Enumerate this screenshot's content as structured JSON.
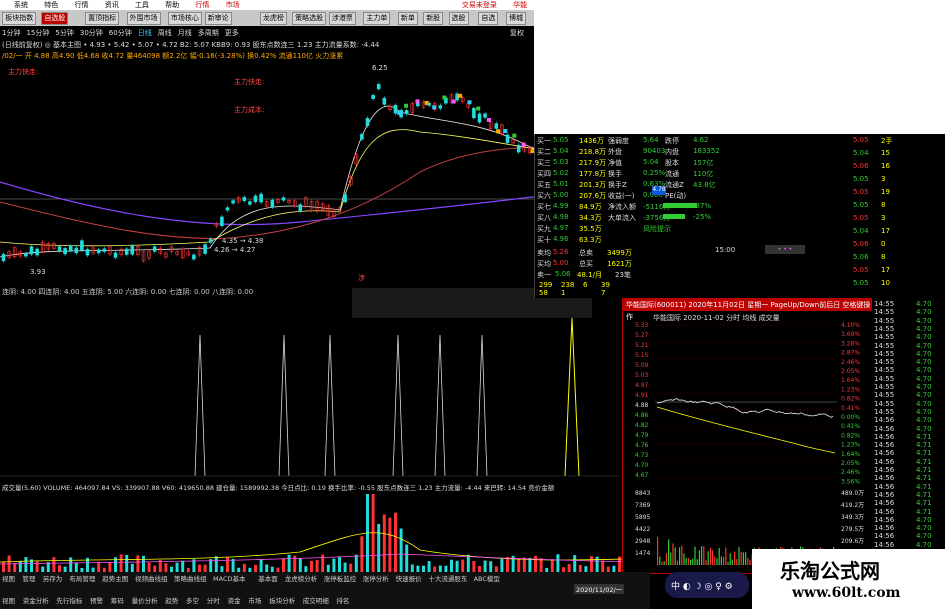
{
  "menu": {
    "tag": "市场",
    "items": [
      "系统",
      "特色",
      "行情",
      "资讯",
      "工具",
      "帮助"
    ],
    "quote_tag": "行情",
    "login": "交易未登录",
    "title": "华能国际"
  },
  "toolbar": {
    "buttons": [
      "板块指数",
      "自选股",
      "置顶指标",
      "外围市场",
      "市场核心",
      "新审论",
      "龙虎榜",
      "策略选股",
      "涉港票",
      "主力单",
      "新单",
      "新股",
      "选股",
      "自选",
      "博城"
    ]
  },
  "info": {
    "line1_left": "日",
    "tf": [
      "1分钟",
      "15分钟",
      "5分钟",
      "30分钟",
      "60分钟",
      "日线",
      "周线",
      "月线",
      "多周期",
      "更多"
    ],
    "restore": "复权",
    "line2": "(日线前复权) ◎ 基本主图  • 4.93  • 5.42  • 5.07  • 4.72  B2: 5.07  KBB9: 0.93     股东点数连三  1.23   主力流量系数:  -4.44",
    "line3": "/02/一 开 4.88  高4.90  低4.68  收4.72  量464098  额2.2亿  幅-0.16(-3.28%)  换0.42%  流通110亿  火力涨累"
  },
  "chart": {
    "high_label": "6.25",
    "low_label": "3.93",
    "l1": "4.35 → 4.38",
    "l2": "4.26 → 4.27",
    "lbl_main": "主力快走:",
    "lbl_cost": "主力成本:",
    "price_marker": "4.78",
    "buy": "涉",
    "sell": "退"
  },
  "ind": {
    "text": "连阴: 4.00  四连阴: 4.00  五连阴: 5.00  六连阴: 0.00  七连阴: 0.00  八连阴: 0.00"
  },
  "vol": {
    "text": "成交量(5,60)  VOLUME: 464097.84  VS: 339907.88  V60: 419650.88   建仓量: 1589992.38   今日点比: 0.19    换手比率: -0.55    股东点数连三 1.23   主力流量: -4.44   来巴转: 14.54  竞价金额"
  },
  "book": [
    {
      "l": "买一",
      "p": "5.05",
      "v": "1436万",
      "k": "强弱度",
      "x": "5.64",
      "k2": "跌停",
      "y": "4.62"
    },
    {
      "l": "买二",
      "p": "5.04",
      "v": "218.8万",
      "k": "外盘",
      "x": "90403",
      "k2": "内盘",
      "y": "183352"
    },
    {
      "l": "买三",
      "p": "5.03",
      "v": "217.9万",
      "k": "净值",
      "x": "5.04",
      "k2": "股本",
      "y": "157亿"
    },
    {
      "l": "买四",
      "p": "5.02",
      "v": "177.8万",
      "k": "换手",
      "x": "0.25%",
      "k2": "流通",
      "y": "110亿"
    },
    {
      "l": "买五",
      "p": "5.01",
      "v": "201.3万",
      "k": "换手Z",
      "x": "0.63%",
      "k2": "流通Z",
      "y": "43.8亿"
    },
    {
      "l": "买六",
      "p": "5.00",
      "v": "207.6万",
      "k": "收益(一)",
      "x": "0.000",
      "k2": "PE(动)",
      "y": ""
    },
    {
      "l": "买七",
      "p": "4.99",
      "v": "84.9万",
      "k": "净流入额",
      "x": "-5116万",
      "k2": "",
      "y": "-37%"
    },
    {
      "l": "买八",
      "p": "4.98",
      "v": "34.3万",
      "k": "大单流入",
      "x": "-3756万",
      "k2": "",
      "y": "-25%"
    },
    {
      "l": "买九",
      "p": "4.97",
      "v": "35.5万",
      "k": "",
      "x": "风险提示",
      "k2": "",
      "y": ""
    },
    {
      "l": "买十",
      "p": "4.96",
      "v": "63.3万",
      "k": "",
      "x": "",
      "k2": "",
      "y": ""
    }
  ],
  "book_sum": [
    {
      "l": "卖均",
      "p": "5.26",
      "k": "总卖",
      "v": "3499万"
    },
    {
      "l": "买均",
      "p": "5.00",
      "k": "总买",
      "v": "1621万"
    }
  ],
  "book_tail": {
    "l": "卖一",
    "p": "5.06",
    "v": "48.1/月",
    "x": "23笔"
  },
  "book_small": [
    {
      "a": "299",
      "b": "238",
      "c": "6",
      "d": "39"
    },
    {
      "a": "58",
      "b": "1",
      "c": "",
      "d": "7"
    }
  ],
  "minute": {
    "title": "华能国际(600011) 2020年11月02日 星期一  PageUp/Down前后日 空格键操作",
    "sub": "华能国际   2020-11-02 分时  均线  成交量",
    "prices": [
      "5.33",
      "5.27",
      "5.21",
      "5.15",
      "5.09",
      "5.03",
      "4.97",
      "4.91",
      "4.88",
      "4.86",
      "4.82",
      "4.79",
      "4.76",
      "4.73",
      "4.70",
      "4.67"
    ],
    "pcts": [
      "4.10%",
      "3.69%",
      "3.28%",
      "2.87%",
      "2.46%",
      "2.05%",
      "1.64%",
      "1.23%",
      "0.82%",
      "0.41%",
      "0.00%",
      "0.41%",
      "0.82%",
      "1.23%",
      "1.64%",
      "2.05%",
      "2.46%",
      "3.56%"
    ],
    "vols": [
      "8843",
      "7369",
      "5895",
      "4422",
      "2948",
      "1474"
    ],
    "vr": [
      "489.0万",
      "419.2万",
      "349.3万",
      "279.5万",
      "209.6万",
      "139.7万"
    ]
  },
  "ticks": [
    {
      "t": "14:55",
      "p": "4.70"
    },
    {
      "t": "14:55",
      "p": "4.70"
    },
    {
      "t": "14:55",
      "p": "4.70"
    },
    {
      "t": "14:55",
      "p": "4.70"
    },
    {
      "t": "14:55",
      "p": "4.70"
    },
    {
      "t": "14:55",
      "p": "4.70"
    },
    {
      "t": "14:55",
      "p": "4.70"
    },
    {
      "t": "14:55",
      "p": "4.70"
    },
    {
      "t": "14:55",
      "p": "4.70"
    },
    {
      "t": "14:55",
      "p": "4.70"
    },
    {
      "t": "14:55",
      "p": "4.70"
    },
    {
      "t": "14:55",
      "p": "4.70"
    },
    {
      "t": "14:55",
      "p": "4.70"
    },
    {
      "t": "14:55",
      "p": "4.70"
    },
    {
      "t": "14:56",
      "p": "4.70"
    },
    {
      "t": "14:56",
      "p": "4.70"
    },
    {
      "t": "14:56",
      "p": "4.71"
    },
    {
      "t": "14:56",
      "p": "4.71"
    },
    {
      "t": "14:56",
      "p": "4.71"
    },
    {
      "t": "14:56",
      "p": "4.71"
    },
    {
      "t": "14:56",
      "p": "4.71"
    },
    {
      "t": "14:56",
      "p": "4.71"
    },
    {
      "t": "14:56",
      "p": "4.71"
    },
    {
      "t": "14:56",
      "p": "4.71"
    },
    {
      "t": "14:56",
      "p": "4.71"
    },
    {
      "t": "14:56",
      "p": "4.71"
    },
    {
      "t": "14:56",
      "p": "4.70"
    },
    {
      "t": "14:56",
      "p": "4.70"
    },
    {
      "t": "14:56",
      "p": "4.70"
    },
    {
      "t": "14:56",
      "p": "4.70"
    }
  ],
  "right_upper": {
    "time": "15:00",
    "vals": [
      "5.05",
      "5.04",
      "5.06",
      "5.05",
      "5.05",
      "5.05",
      "5.05",
      "5.04",
      "5.06",
      "5.06",
      "5.05",
      "5.05"
    ],
    "qty": [
      "2手",
      "15",
      "16",
      "3",
      "19",
      "8",
      "3",
      "17",
      "0",
      "8",
      "17",
      "10"
    ]
  },
  "bottom": {
    "tabs1": [
      "视图",
      "管理",
      "另存为",
      "布局管理",
      "趋势主图",
      "视频曲线组",
      "策略曲线组",
      "MACD基本",
      "基本面",
      "龙虎榜分析",
      "涨停板监控",
      "涨停分析",
      "快速报价",
      "十大流通股东",
      "ABC模型"
    ],
    "tabs2": [
      "视图",
      "资金分析",
      "先行指标",
      "预警",
      "筹码",
      "量价分析",
      "趋势",
      "多空",
      "分时",
      "资金",
      "市场",
      "板块分析",
      "成交明细",
      "排名"
    ],
    "date": "2020/11/02/一"
  },
  "brand": {
    "name": "乐淘公式网",
    "url": "www.60lt.com"
  },
  "colors": {
    "up": "#ff3333",
    "down": "#22dddd",
    "ma5": "#ffffff",
    "ma10": "#ffff00",
    "ma20": "#ff44ff",
    "ma60": "#8844ff"
  }
}
